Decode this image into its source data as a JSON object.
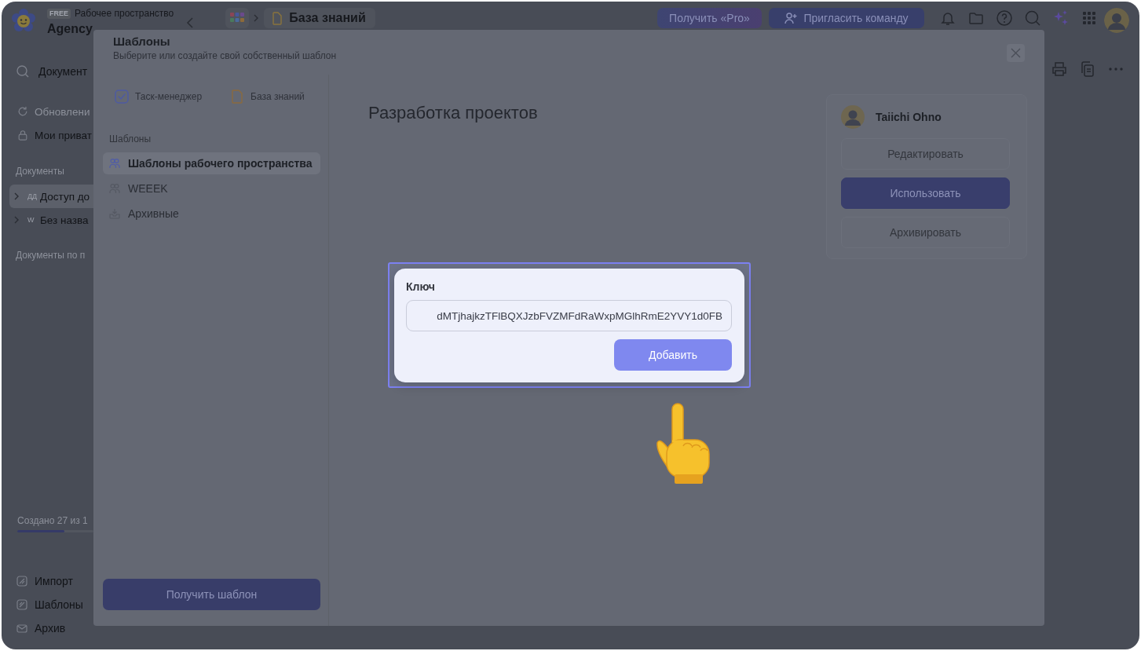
{
  "workspace": {
    "badge": "FREE",
    "label": "Рабочее пространство",
    "name": "Agency"
  },
  "breadcrumb": {
    "page": "База знаний"
  },
  "header_buttons": [
    {
      "kind": "pro",
      "label": "Получить «Pro»"
    },
    {
      "kind": "invite",
      "label": "Пригласить команду"
    }
  ],
  "sidebar": {
    "search": {
      "placeholder": "Документ"
    },
    "nav": [
      {
        "kind": "updates",
        "label": "Обновлени"
      },
      {
        "kind": "private",
        "label": "Мои приват"
      }
    ],
    "documents_heading": "Документы",
    "documents": [
      {
        "prefix": "ДД",
        "label": "Доступ до",
        "selected": true
      },
      {
        "prefix": "W",
        "label": "Без назва",
        "selected": false
      }
    ],
    "shared_heading": "Документы по п",
    "quota": {
      "label": "Создано 27 из 1",
      "level": 0.62
    },
    "footer": [
      {
        "kind": "import",
        "label": "Импорт"
      },
      {
        "kind": "templates",
        "label": "Шаблоны"
      },
      {
        "kind": "archive",
        "label": "Архив"
      }
    ]
  },
  "templates_dialog": {
    "title": "Шаблоны",
    "subtitle": "Выберите или создайте свой собственный шаблон",
    "sources": [
      {
        "kind": "tasks",
        "label": "Таск-менеджер"
      },
      {
        "kind": "knowledge",
        "label": "База знаний"
      }
    ],
    "list_heading": "Шаблоны",
    "lists": [
      {
        "kind": "team",
        "label": "Шаблоны рабочего пространства",
        "selected": true
      },
      {
        "kind": "team",
        "label": "WEEEK",
        "selected": false
      },
      {
        "kind": "archive",
        "label": "Архивные",
        "selected": false
      }
    ],
    "get_button": "Получить шаблон",
    "template": {
      "title": "Разработка проектов",
      "author": "Taiichi Ohno",
      "actions": [
        {
          "kind": "secondary",
          "label": "Редактировать"
        },
        {
          "kind": "primary",
          "label": "Использовать"
        },
        {
          "kind": "secondary",
          "label": "Архивировать"
        }
      ]
    }
  },
  "key_dialog": {
    "label": "Ключ",
    "value": "dMTjhajkzTFlBQXJzbFVZMFdRaWxpMGlhRmE2YVY1d0FB",
    "button": "Добавить"
  }
}
